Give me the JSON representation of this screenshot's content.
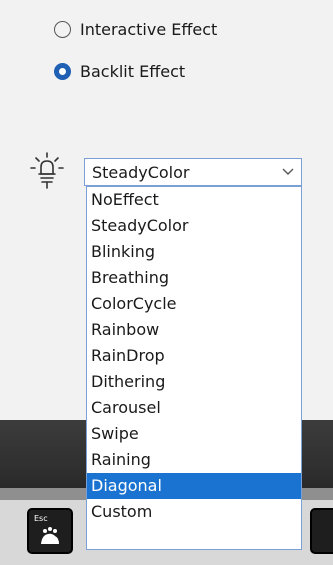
{
  "effects": {
    "interactive_label": "Interactive Effect",
    "backlit_label": "Backlit Effect",
    "selected": "backlit"
  },
  "effect_select": {
    "value": "SteadyColor",
    "icon": "lightbulb-icon",
    "options": [
      "NoEffect",
      "SteadyColor",
      "Blinking",
      "Breathing",
      "ColorCycle",
      "Rainbow",
      "RainDrop",
      "Dithering",
      "Carousel",
      "Swipe",
      "Raining",
      "Diagonal",
      "Custom"
    ],
    "highlighted": "Diagonal"
  },
  "keyboard": {
    "esc_label": "Esc"
  },
  "colors": {
    "accent": "#1a73d0",
    "radio_on": "#1f5fb4",
    "select_border": "#7aa0d6"
  }
}
